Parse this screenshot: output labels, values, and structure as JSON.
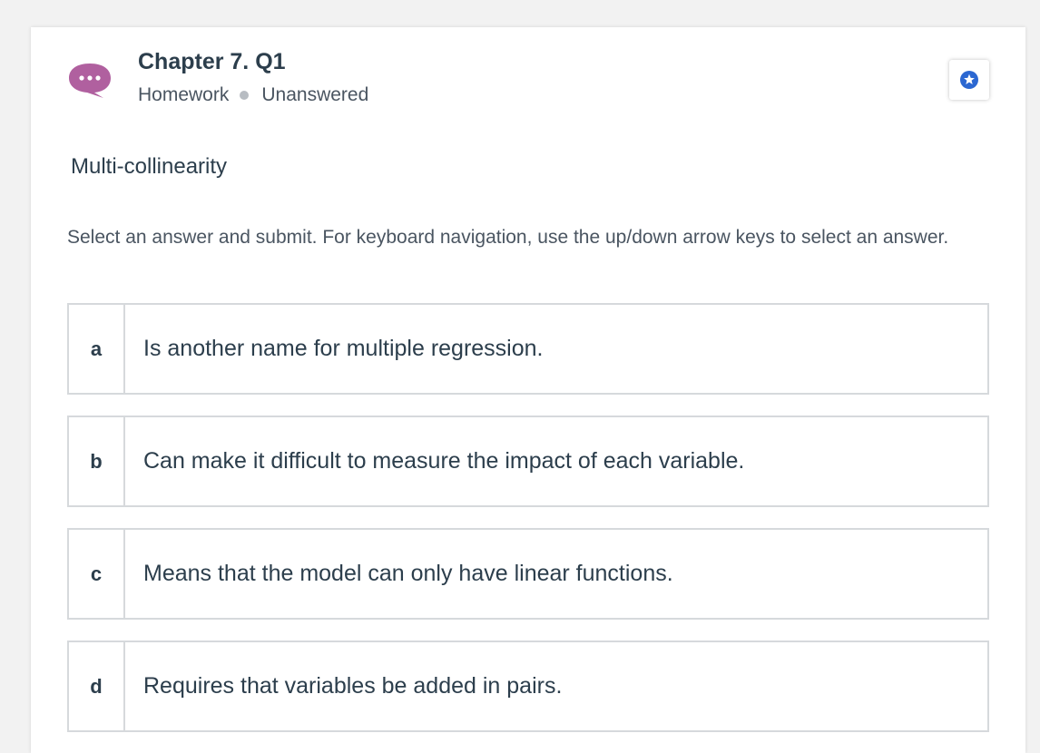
{
  "question": {
    "title": "Chapter 7. Q1",
    "type": "Homework",
    "status": "Unanswered",
    "topic": "Multi-collinearity",
    "instructions": "Select an answer and submit. For keyboard navigation, use the up/down arrow keys to select an answer."
  },
  "icons": {
    "question_icon": "speech-bubble-icon",
    "star": "star-icon"
  },
  "colors": {
    "question_icon": "#b0609f",
    "star": "#2b67d1",
    "text": "#2c3e4c"
  },
  "answers": [
    {
      "letter": "a",
      "text": "Is another name for multiple regression."
    },
    {
      "letter": "b",
      "text": "Can make it difficult to measure the impact of each variable."
    },
    {
      "letter": "c",
      "text": "Means that the model can only have linear functions."
    },
    {
      "letter": "d",
      "text": "Requires that variables be added in pairs."
    }
  ]
}
